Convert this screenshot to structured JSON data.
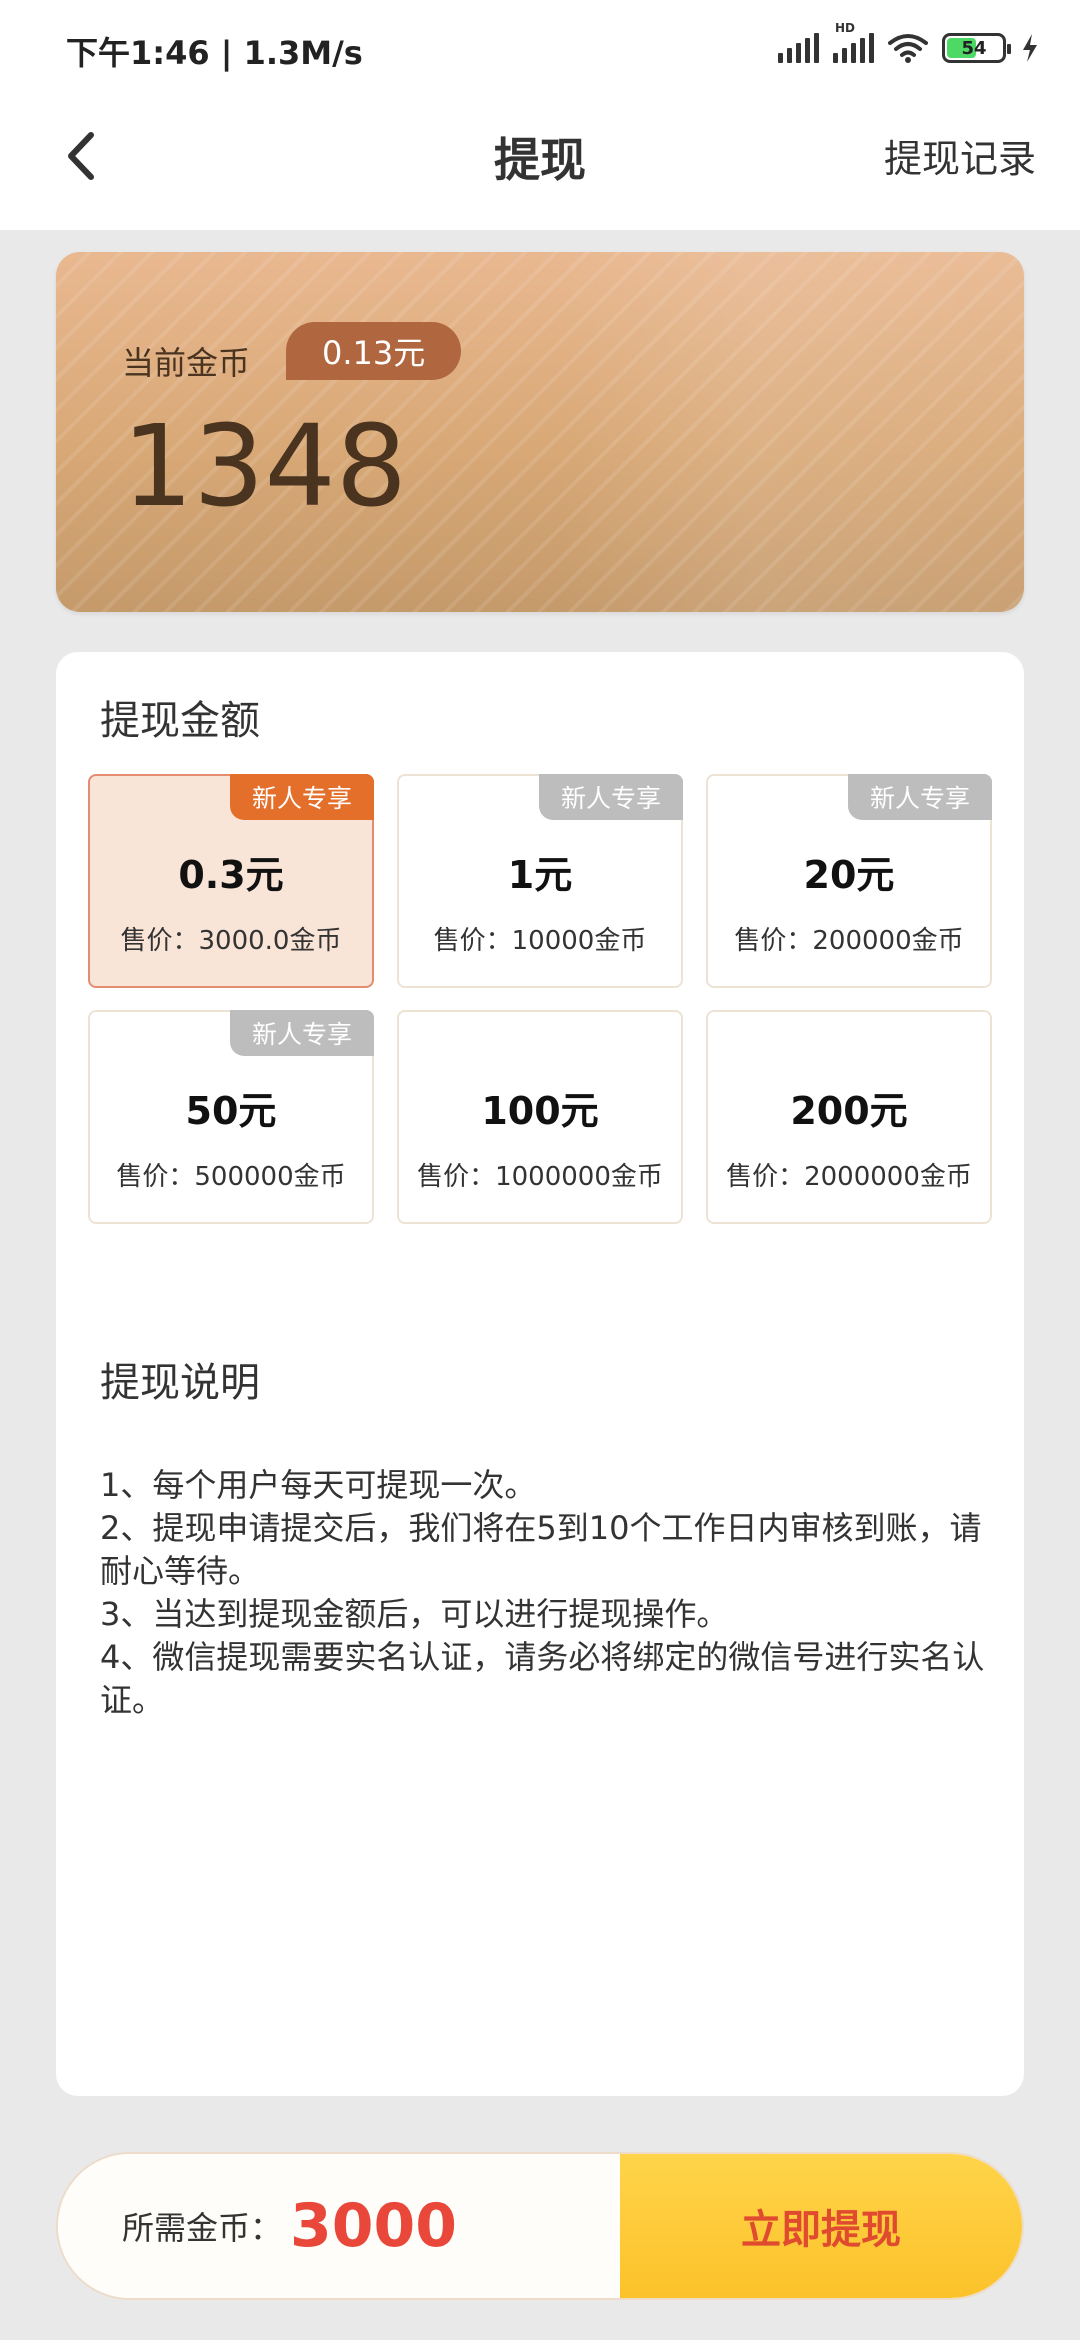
{
  "status_bar": {
    "time": "下午1:46 | 1.3M/s",
    "battery": "54",
    "hd_label": "HD"
  },
  "header": {
    "title": "提现",
    "record_link": "提现记录"
  },
  "coin_card": {
    "label": "当前金币",
    "cash_value": "0.13元",
    "coins": "1348"
  },
  "withdraw": {
    "section_title": "提现金额",
    "options": [
      {
        "tag": "新人专享",
        "value": "0.3元",
        "price": "售价：3000.0金币"
      },
      {
        "tag": "新人专享",
        "value": "1元",
        "price": "售价：10000金币"
      },
      {
        "tag": "新人专享",
        "value": "20元",
        "price": "售价：200000金币"
      },
      {
        "tag": "新人专享",
        "value": "50元",
        "price": "售价：500000金币"
      },
      {
        "tag": "",
        "value": "100元",
        "price": "售价：1000000金币"
      },
      {
        "tag": "",
        "value": "200元",
        "price": "售价：2000000金币"
      }
    ]
  },
  "instructions": {
    "title": "提现说明",
    "lines": [
      "1、每个用户每天可提现一次。",
      "2、提现申请提交后，我们将在5到10个工作日内审核到账，请耐心等待。",
      "3、当达到提现金额后，可以进行提现操作。",
      "4、微信提现需要实名认证，请务必将绑定的微信号进行实名认证。"
    ]
  },
  "bottom_bar": {
    "need_label": "所需金币：",
    "need_value": "3000",
    "submit_label": "立即提现"
  },
  "colors": {
    "accent_orange": "#e46f2a",
    "button_yellow": "#fcc22a",
    "price_red": "#e8473a",
    "card_gold": "#d8a876"
  }
}
